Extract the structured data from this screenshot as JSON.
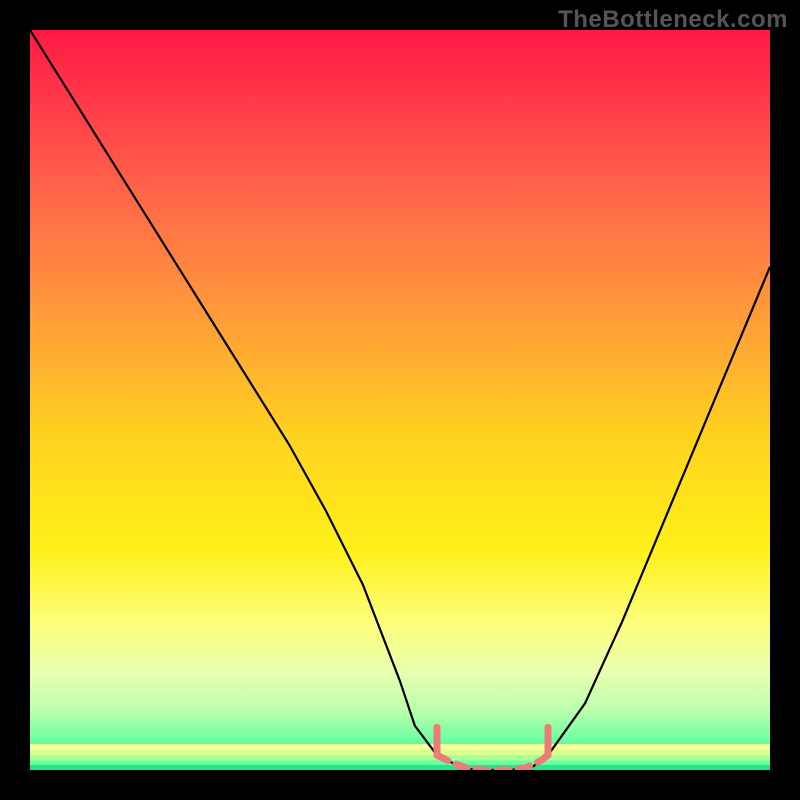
{
  "watermark": "TheBottleneck.com",
  "colors": {
    "frame": "#000000",
    "curve": "#000000",
    "marker": "#ed7b78",
    "gradient_stops": [
      {
        "offset": 0.0,
        "color": "#ff1a44"
      },
      {
        "offset": 0.1,
        "color": "#ff3b4a"
      },
      {
        "offset": 0.25,
        "color": "#ff6f47"
      },
      {
        "offset": 0.4,
        "color": "#ffa038"
      },
      {
        "offset": 0.55,
        "color": "#ffd21f"
      },
      {
        "offset": 0.7,
        "color": "#fff019"
      },
      {
        "offset": 0.8,
        "color": "#fdff7a"
      },
      {
        "offset": 0.87,
        "color": "#e8ffb0"
      },
      {
        "offset": 0.92,
        "color": "#b9ffaf"
      },
      {
        "offset": 0.96,
        "color": "#6dffa1"
      },
      {
        "offset": 1.0,
        "color": "#00e97a"
      }
    ]
  },
  "chart_data": {
    "type": "line",
    "title": "",
    "xlabel": "",
    "ylabel": "",
    "xlim": [
      0,
      100
    ],
    "ylim": [
      0,
      100
    ],
    "x": [
      0,
      5,
      10,
      15,
      20,
      25,
      30,
      35,
      40,
      45,
      50,
      52,
      55,
      58,
      60,
      62,
      65,
      68,
      70,
      75,
      80,
      85,
      90,
      95,
      100
    ],
    "values": [
      100,
      92,
      84,
      76,
      68,
      60,
      52,
      44,
      35,
      25,
      12,
      6,
      2,
      0.5,
      0,
      0,
      0,
      0.5,
      2,
      9,
      20,
      32,
      44,
      56,
      68
    ],
    "optimal_range_x": [
      55,
      70
    ],
    "marker_points_x": [
      55,
      57,
      59,
      61,
      63,
      65,
      67,
      69,
      70
    ],
    "note": "Values estimated from pixel positions; y=0 is the flat valley at bottom, y=100 is top of plot. Curve is a V / check-mark shape with a flat minimum between x≈55 and x≈70, left branch reaching the top-left corner, right branch rising to ≈68 at the right edge."
  }
}
